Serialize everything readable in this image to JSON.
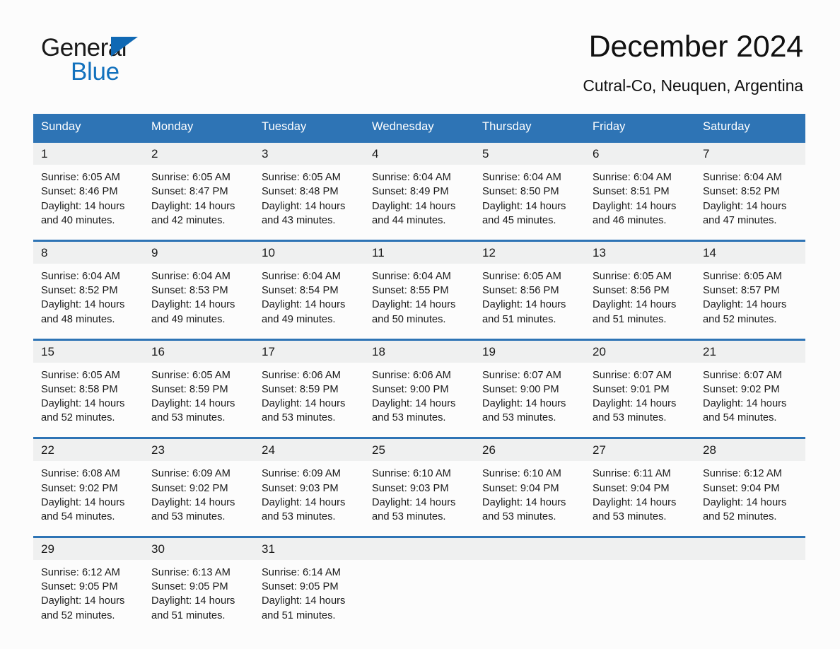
{
  "brand": {
    "name_part1": "General",
    "name_part2": "Blue",
    "triangle_color": "#1069b4",
    "blue_color": "#1271bd"
  },
  "header": {
    "month_title": "December 2024",
    "location": "Cutral-Co, Neuquen, Argentina"
  },
  "theme": {
    "header_blue": "#2e74b5",
    "daynum_bg": "#eff0f0",
    "page_bg": "#fcfcfc",
    "text": "#1a1a1a"
  },
  "calendar": {
    "weekday_headers": [
      "Sunday",
      "Monday",
      "Tuesday",
      "Wednesday",
      "Thursday",
      "Friday",
      "Saturday"
    ],
    "weeks": [
      [
        {
          "day": "1",
          "sunrise": "Sunrise: 6:05 AM",
          "sunset": "Sunset: 8:46 PM",
          "daylight": "Daylight: 14 hours and 40 minutes."
        },
        {
          "day": "2",
          "sunrise": "Sunrise: 6:05 AM",
          "sunset": "Sunset: 8:47 PM",
          "daylight": "Daylight: 14 hours and 42 minutes."
        },
        {
          "day": "3",
          "sunrise": "Sunrise: 6:05 AM",
          "sunset": "Sunset: 8:48 PM",
          "daylight": "Daylight: 14 hours and 43 minutes."
        },
        {
          "day": "4",
          "sunrise": "Sunrise: 6:04 AM",
          "sunset": "Sunset: 8:49 PM",
          "daylight": "Daylight: 14 hours and 44 minutes."
        },
        {
          "day": "5",
          "sunrise": "Sunrise: 6:04 AM",
          "sunset": "Sunset: 8:50 PM",
          "daylight": "Daylight: 14 hours and 45 minutes."
        },
        {
          "day": "6",
          "sunrise": "Sunrise: 6:04 AM",
          "sunset": "Sunset: 8:51 PM",
          "daylight": "Daylight: 14 hours and 46 minutes."
        },
        {
          "day": "7",
          "sunrise": "Sunrise: 6:04 AM",
          "sunset": "Sunset: 8:52 PM",
          "daylight": "Daylight: 14 hours and 47 minutes."
        }
      ],
      [
        {
          "day": "8",
          "sunrise": "Sunrise: 6:04 AM",
          "sunset": "Sunset: 8:52 PM",
          "daylight": "Daylight: 14 hours and 48 minutes."
        },
        {
          "day": "9",
          "sunrise": "Sunrise: 6:04 AM",
          "sunset": "Sunset: 8:53 PM",
          "daylight": "Daylight: 14 hours and 49 minutes."
        },
        {
          "day": "10",
          "sunrise": "Sunrise: 6:04 AM",
          "sunset": "Sunset: 8:54 PM",
          "daylight": "Daylight: 14 hours and 49 minutes."
        },
        {
          "day": "11",
          "sunrise": "Sunrise: 6:04 AM",
          "sunset": "Sunset: 8:55 PM",
          "daylight": "Daylight: 14 hours and 50 minutes."
        },
        {
          "day": "12",
          "sunrise": "Sunrise: 6:05 AM",
          "sunset": "Sunset: 8:56 PM",
          "daylight": "Daylight: 14 hours and 51 minutes."
        },
        {
          "day": "13",
          "sunrise": "Sunrise: 6:05 AM",
          "sunset": "Sunset: 8:56 PM",
          "daylight": "Daylight: 14 hours and 51 minutes."
        },
        {
          "day": "14",
          "sunrise": "Sunrise: 6:05 AM",
          "sunset": "Sunset: 8:57 PM",
          "daylight": "Daylight: 14 hours and 52 minutes."
        }
      ],
      [
        {
          "day": "15",
          "sunrise": "Sunrise: 6:05 AM",
          "sunset": "Sunset: 8:58 PM",
          "daylight": "Daylight: 14 hours and 52 minutes."
        },
        {
          "day": "16",
          "sunrise": "Sunrise: 6:05 AM",
          "sunset": "Sunset: 8:59 PM",
          "daylight": "Daylight: 14 hours and 53 minutes."
        },
        {
          "day": "17",
          "sunrise": "Sunrise: 6:06 AM",
          "sunset": "Sunset: 8:59 PM",
          "daylight": "Daylight: 14 hours and 53 minutes."
        },
        {
          "day": "18",
          "sunrise": "Sunrise: 6:06 AM",
          "sunset": "Sunset: 9:00 PM",
          "daylight": "Daylight: 14 hours and 53 minutes."
        },
        {
          "day": "19",
          "sunrise": "Sunrise: 6:07 AM",
          "sunset": "Sunset: 9:00 PM",
          "daylight": "Daylight: 14 hours and 53 minutes."
        },
        {
          "day": "20",
          "sunrise": "Sunrise: 6:07 AM",
          "sunset": "Sunset: 9:01 PM",
          "daylight": "Daylight: 14 hours and 53 minutes."
        },
        {
          "day": "21",
          "sunrise": "Sunrise: 6:07 AM",
          "sunset": "Sunset: 9:02 PM",
          "daylight": "Daylight: 14 hours and 54 minutes."
        }
      ],
      [
        {
          "day": "22",
          "sunrise": "Sunrise: 6:08 AM",
          "sunset": "Sunset: 9:02 PM",
          "daylight": "Daylight: 14 hours and 54 minutes."
        },
        {
          "day": "23",
          "sunrise": "Sunrise: 6:09 AM",
          "sunset": "Sunset: 9:02 PM",
          "daylight": "Daylight: 14 hours and 53 minutes."
        },
        {
          "day": "24",
          "sunrise": "Sunrise: 6:09 AM",
          "sunset": "Sunset: 9:03 PM",
          "daylight": "Daylight: 14 hours and 53 minutes."
        },
        {
          "day": "25",
          "sunrise": "Sunrise: 6:10 AM",
          "sunset": "Sunset: 9:03 PM",
          "daylight": "Daylight: 14 hours and 53 minutes."
        },
        {
          "day": "26",
          "sunrise": "Sunrise: 6:10 AM",
          "sunset": "Sunset: 9:04 PM",
          "daylight": "Daylight: 14 hours and 53 minutes."
        },
        {
          "day": "27",
          "sunrise": "Sunrise: 6:11 AM",
          "sunset": "Sunset: 9:04 PM",
          "daylight": "Daylight: 14 hours and 53 minutes."
        },
        {
          "day": "28",
          "sunrise": "Sunrise: 6:12 AM",
          "sunset": "Sunset: 9:04 PM",
          "daylight": "Daylight: 14 hours and 52 minutes."
        }
      ],
      [
        {
          "day": "29",
          "sunrise": "Sunrise: 6:12 AM",
          "sunset": "Sunset: 9:05 PM",
          "daylight": "Daylight: 14 hours and 52 minutes."
        },
        {
          "day": "30",
          "sunrise": "Sunrise: 6:13 AM",
          "sunset": "Sunset: 9:05 PM",
          "daylight": "Daylight: 14 hours and 51 minutes."
        },
        {
          "day": "31",
          "sunrise": "Sunrise: 6:14 AM",
          "sunset": "Sunset: 9:05 PM",
          "daylight": "Daylight: 14 hours and 51 minutes."
        },
        {
          "day": "",
          "sunrise": "",
          "sunset": "",
          "daylight": ""
        },
        {
          "day": "",
          "sunrise": "",
          "sunset": "",
          "daylight": ""
        },
        {
          "day": "",
          "sunrise": "",
          "sunset": "",
          "daylight": ""
        },
        {
          "day": "",
          "sunrise": "",
          "sunset": "",
          "daylight": ""
        }
      ]
    ]
  }
}
